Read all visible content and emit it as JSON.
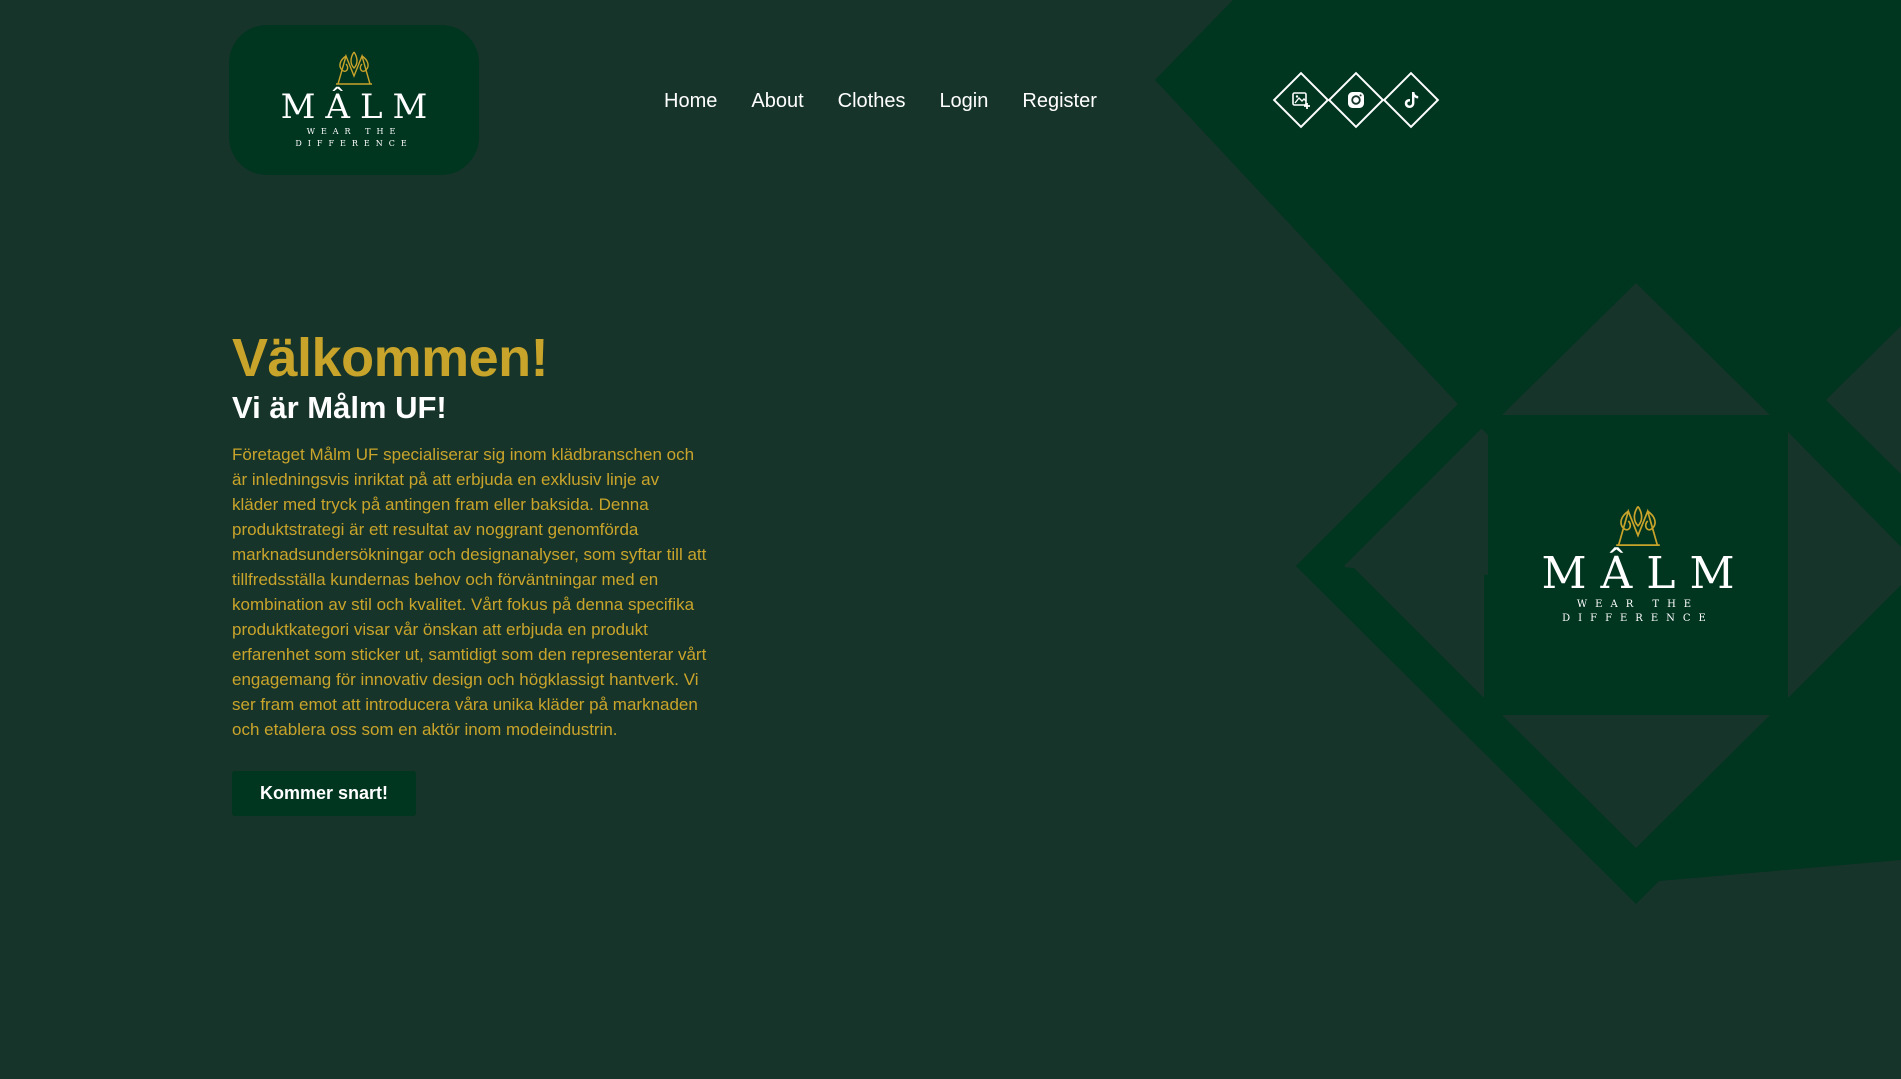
{
  "brand": {
    "name": "MÂLM",
    "tagline_line1": "WEAR THE",
    "tagline_line2": "DIFFERENCE",
    "logo_icon": "malm-monogram-icon"
  },
  "nav": {
    "items": [
      {
        "label": "Home"
      },
      {
        "label": "About"
      },
      {
        "label": "Clothes"
      },
      {
        "label": "Login"
      },
      {
        "label": "Register"
      }
    ]
  },
  "socials": [
    {
      "icon": "image-plus-icon"
    },
    {
      "icon": "instagram-icon"
    },
    {
      "icon": "tiktok-icon"
    }
  ],
  "hero": {
    "title": "Välkommen!",
    "subtitle": "Vi är Målm UF!",
    "body": "Företaget Målm UF specialiserar sig inom klädbranschen och är inledningsvis inriktat på att erbjuda en exklusiv linje av kläder med tryck på antingen fram eller baksida. Denna produktstrategi är ett resultat av noggrant genomförda marknadsundersökningar och designanalyser, som syftar till att tillfredsställa kundernas behov och förväntningar med en kombination av stil och kvalitet. Vårt fokus på denna specifika produktkategori visar vår önskan att erbjuda en produkt erfarenhet som sticker ut, samtidigt som den representerar vårt engagemang för innovativ design och högklassigt hantverk. Vi ser fram emot att introducera våra unika kläder på marknaden och etablera oss som en aktör inom modeindustrin.",
    "cta_label": "Kommer snart!"
  },
  "colors": {
    "background": "#17342a",
    "dark_green": "#003520",
    "gold": "#c9a42a",
    "white": "#ffffff"
  }
}
